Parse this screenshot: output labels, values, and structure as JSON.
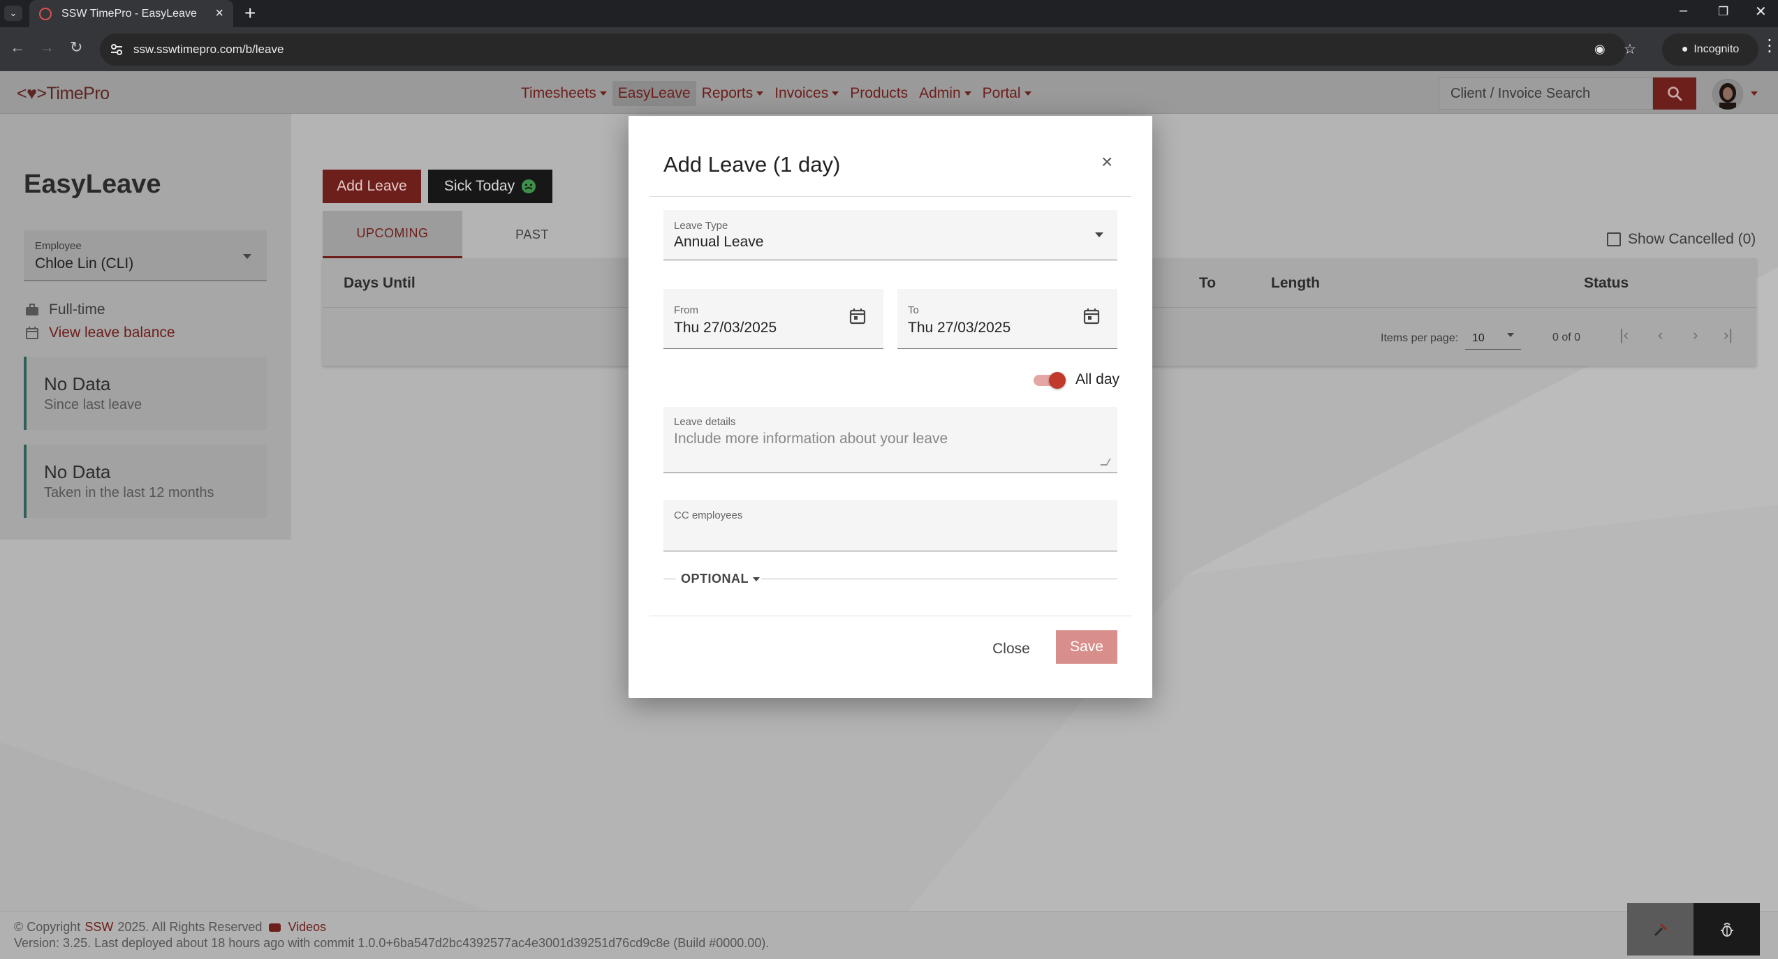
{
  "browser": {
    "tab_title": "SSW TimePro - EasyLeave",
    "url": "ssw.sswtimepro.com/b/leave",
    "incognito_label": "Incognito"
  },
  "header": {
    "logo": "<♥>TimePro",
    "nav": [
      {
        "label": "Timesheets",
        "dropdown": true
      },
      {
        "label": "EasyLeave",
        "dropdown": false,
        "active": true
      },
      {
        "label": "Reports",
        "dropdown": true
      },
      {
        "label": "Invoices",
        "dropdown": true
      },
      {
        "label": "Products",
        "dropdown": false
      },
      {
        "label": "Admin",
        "dropdown": true
      },
      {
        "label": "Portal",
        "dropdown": true
      }
    ],
    "search_placeholder": "Client / Invoice Search"
  },
  "page": {
    "title": "EasyLeave",
    "employee_label": "Employee",
    "employee_value": "Chloe Lin (CLI)",
    "employment_type": "Full-time",
    "view_balance_link": "View leave balance",
    "stats": [
      {
        "value": "No Data",
        "caption": "Since last leave"
      },
      {
        "value": "No Data",
        "caption": "Taken in the last 12 months"
      }
    ],
    "add_leave_button": "Add Leave",
    "sick_today_button": "Sick Today",
    "tabs": [
      "UPCOMING",
      "PAST"
    ],
    "show_cancelled": "Show Cancelled (0)",
    "table_headers": [
      "Days Until",
      "To",
      "Length",
      "Status"
    ],
    "items_per_page_label": "Items per page:",
    "items_per_page_value": "10",
    "range_label": "0 of 0"
  },
  "modal": {
    "title": "Add Leave (1 day)",
    "leave_type_label": "Leave Type",
    "leave_type_value": "Annual Leave",
    "from_label": "From",
    "from_value": "Thu 27/03/2025",
    "to_label": "To",
    "to_value": "Thu 27/03/2025",
    "all_day_label": "All day",
    "all_day_on": true,
    "details_label": "Leave details",
    "details_placeholder": "Include more information about your leave",
    "cc_label": "CC employees",
    "optional_label": "OPTIONAL",
    "close_button": "Close",
    "save_button": "Save"
  },
  "footer": {
    "copyright_prefix": "© Copyright",
    "copyright_company": "SSW",
    "copyright_suffix": "2025. All Rights Reserved",
    "videos_link": "Videos",
    "version_line": "Version: 3.25. Last deployed about 18 hours ago with commit 1.0.0+6ba547d2bc4392577ac4e3001d39251d76cd9c8e (Build #0000.00)."
  },
  "colors": {
    "brand": "#6d1f1c",
    "save_disabled": "#d88e8a",
    "toggle_on": "#c0392b"
  }
}
